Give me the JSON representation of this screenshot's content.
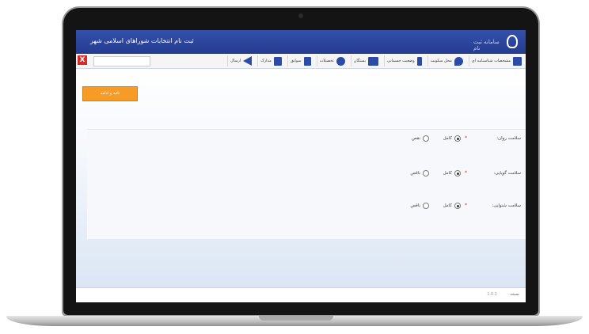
{
  "app": {
    "title": "ثبت نام انتخابات شوراهای اسلامی شهر",
    "logo_text": "سامانه ثبت نام"
  },
  "toolbar": {
    "items": [
      {
        "label": "مشخصات شناسنامه ای",
        "icon": "id-card-icon",
        "color": "#2b4ba6"
      },
      {
        "label": "محل سکونت",
        "icon": "location-pin-icon",
        "color": "#2b4ba6"
      },
      {
        "label": "وضعیت جسمانی",
        "icon": "person-icon",
        "color": "#2b4ba6"
      },
      {
        "label": "بستگان",
        "icon": "family-icon",
        "color": "#2b4ba6"
      },
      {
        "label": "تحصیلات",
        "icon": "graduation-cap-icon",
        "color": "#2b4ba6"
      },
      {
        "label": "سوابق",
        "icon": "document-icon",
        "color": "#2b4ba6"
      },
      {
        "label": "مدارک",
        "icon": "files-icon",
        "color": "#2b4ba6"
      },
      {
        "label": "ارسال",
        "icon": "send-arrow-icon",
        "color": "#2b4ba6"
      }
    ],
    "close_label": "X"
  },
  "main": {
    "confirm_button": "تائید و ادامه",
    "rows": [
      {
        "label": "سلامت روان:",
        "options": [
          "کامل",
          "نقص"
        ],
        "selected": 0
      },
      {
        "label": "سلامت گویایی:",
        "options": [
          "کامل",
          "ناقص"
        ],
        "selected": 0
      },
      {
        "label": "سلامت شنوایی:",
        "options": [
          "کامل",
          "ناقص"
        ],
        "selected": 0
      }
    ]
  },
  "footer": {
    "text": "نسخه",
    "version": "1.0.1"
  },
  "colors": {
    "header": "#2b4ba6",
    "accent_button": "#f59b26",
    "close": "#d42b2b"
  }
}
